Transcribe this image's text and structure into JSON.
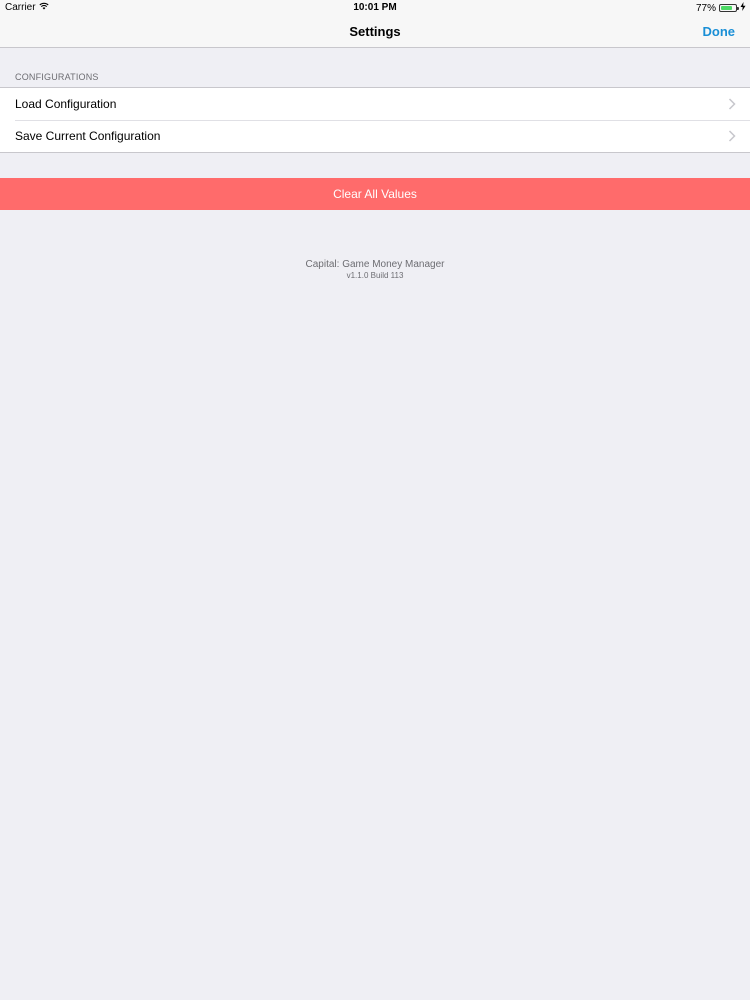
{
  "status_bar": {
    "carrier": "Carrier",
    "time": "10:01 PM",
    "battery_text": "77%",
    "battery_level": 0.77,
    "icons": [
      "wifi-icon",
      "battery-icon",
      "charging-icon"
    ]
  },
  "nav": {
    "title": "Settings",
    "done_label": "Done"
  },
  "configurations": {
    "header": "CONFIGURATIONS",
    "items": [
      {
        "label": "Load Configuration",
        "icon": "chevron-right-icon"
      },
      {
        "label": "Save Current Configuration",
        "icon": "chevron-right-icon"
      }
    ]
  },
  "actions": {
    "clear_label": "Clear All Values"
  },
  "footer": {
    "app_name": "Capital: Game Money Manager",
    "version": "v1.1.0 Build 113"
  },
  "colors": {
    "accent": "#1a8fd6",
    "destructive": "#ff6b6b",
    "background": "#efeff4"
  }
}
